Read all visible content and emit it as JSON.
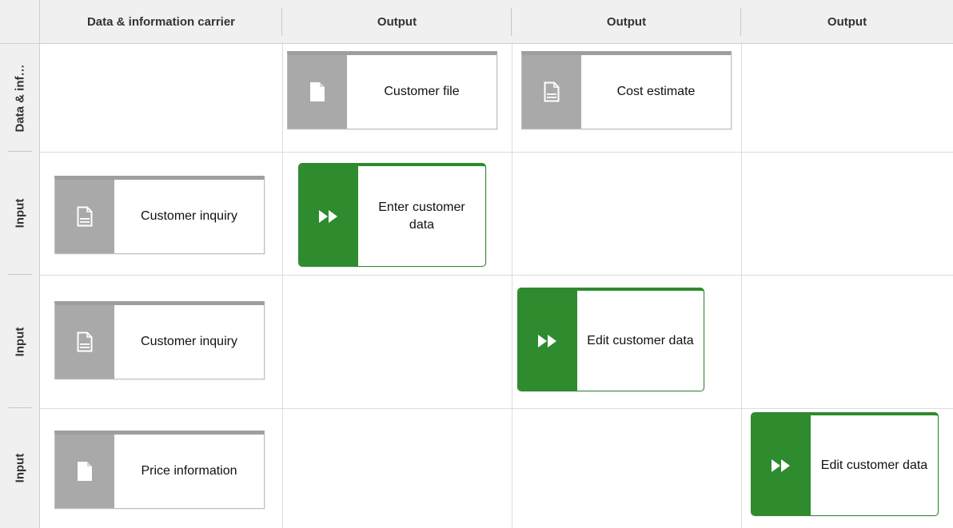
{
  "columns": {
    "carrier": "Data & information carrier",
    "output1": "Output",
    "output2": "Output",
    "output3": "Output"
  },
  "rows": {
    "row1": "Data & inf…",
    "row2": "Input",
    "row3": "Input",
    "row4": "Input"
  },
  "objects": {
    "customer_file": "Customer file",
    "cost_estimate": "Cost estimate",
    "customer_inquiry_1": "Customer inquiry",
    "enter_customer_data": "Enter customer data",
    "customer_inquiry_2": "Customer inquiry",
    "edit_customer_data_1": "Edit customer data",
    "price_information": "Price information",
    "edit_customer_data_2": "Edit customer data"
  },
  "colors": {
    "function_green": "#2e8b2e",
    "info_gray": "#a9a9a9",
    "header_bg": "#f0f0f0"
  },
  "icons": {
    "document": "document-icon",
    "text_document": "text-document-icon",
    "function": "fast-forward-icon"
  }
}
